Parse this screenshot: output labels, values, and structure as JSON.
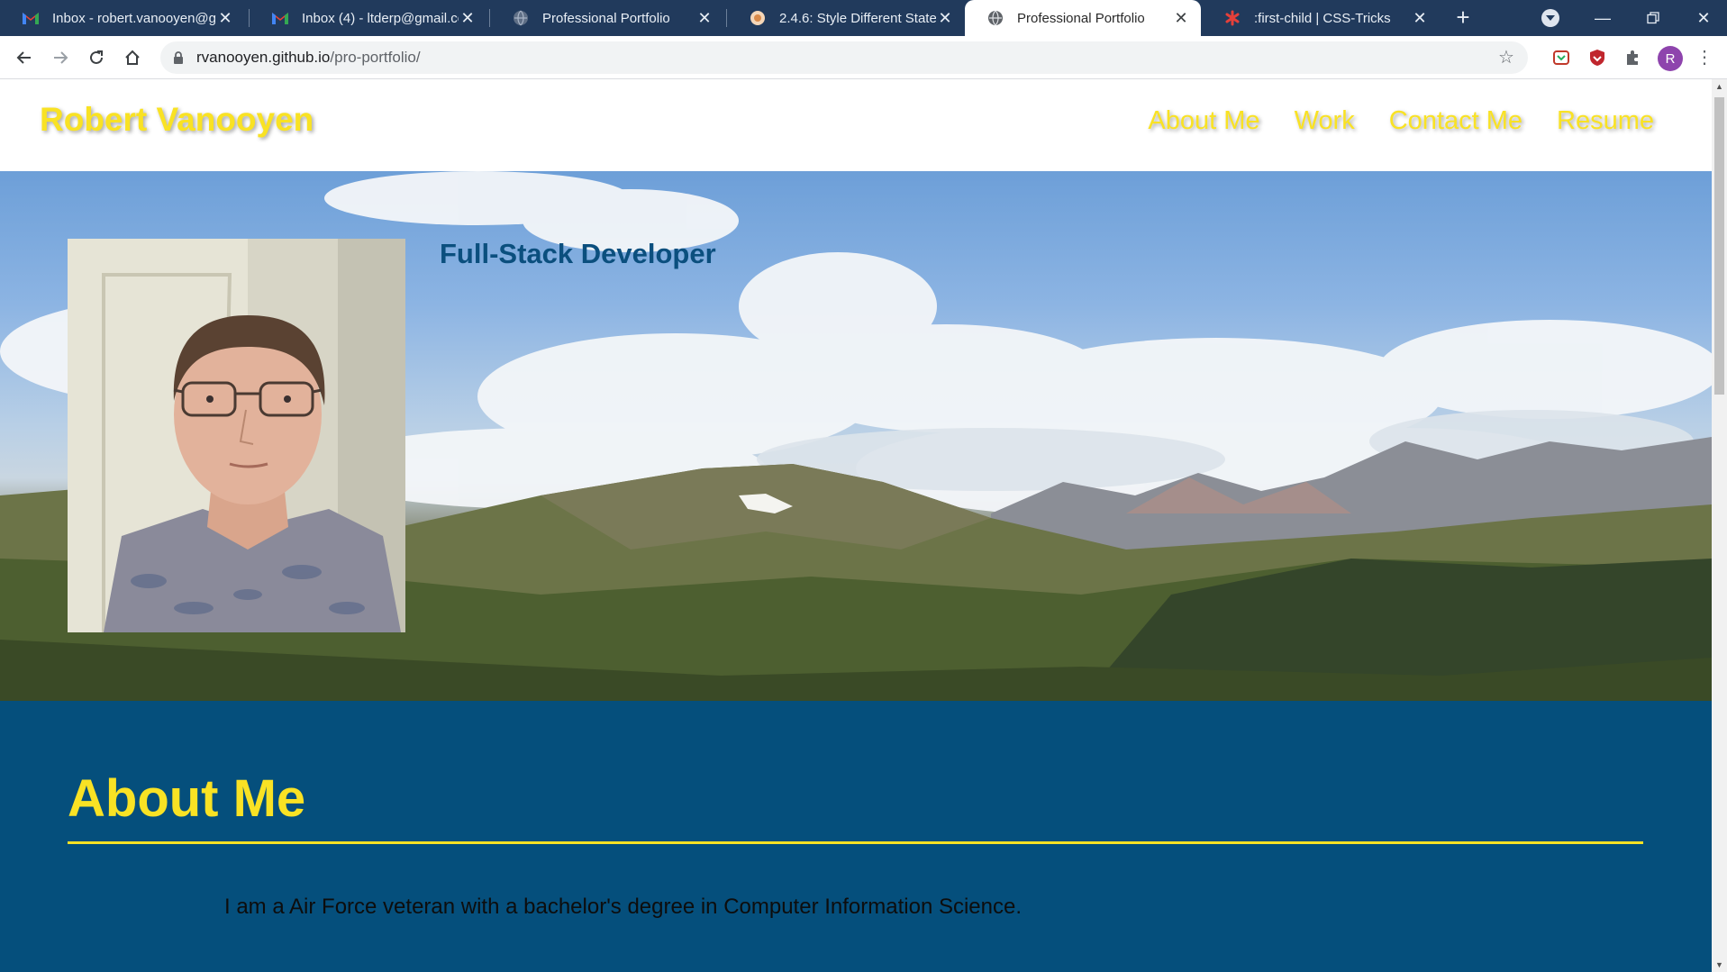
{
  "browser": {
    "tabs": [
      {
        "title": "Inbox - robert.vanooyen@g",
        "icon": "gmail-icon"
      },
      {
        "title": "Inbox (4) - ltderp@gmail.co",
        "icon": "gmail-icon"
      },
      {
        "title": "Professional Portfolio",
        "icon": "globe-icon"
      },
      {
        "title": "2.4.6: Style Different States",
        "icon": "bootcamp-icon"
      },
      {
        "title": "Professional Portfolio",
        "icon": "globe-icon",
        "active": true
      },
      {
        "title": ":first-child | CSS-Tricks",
        "icon": "css-tricks-icon"
      }
    ],
    "url": {
      "host": "rvanooyen.github.io",
      "path": "/pro-portfolio/"
    },
    "profile_initial": "R"
  },
  "site": {
    "name": "Robert Vanooyen",
    "nav": [
      "About Me",
      "Work",
      "Contact Me",
      "Resume"
    ],
    "hero_subtitle": "Full-Stack Developer",
    "about": {
      "heading": "About Me",
      "text": "I am a Air Force veteran with a bachelor's degree in Computer Information Science."
    }
  },
  "colors": {
    "accent_yellow": "#f9e224",
    "about_bg": "#054f7c",
    "subtitle_blue": "#0b4f7e",
    "tabstrip_bg": "#213a5c"
  }
}
